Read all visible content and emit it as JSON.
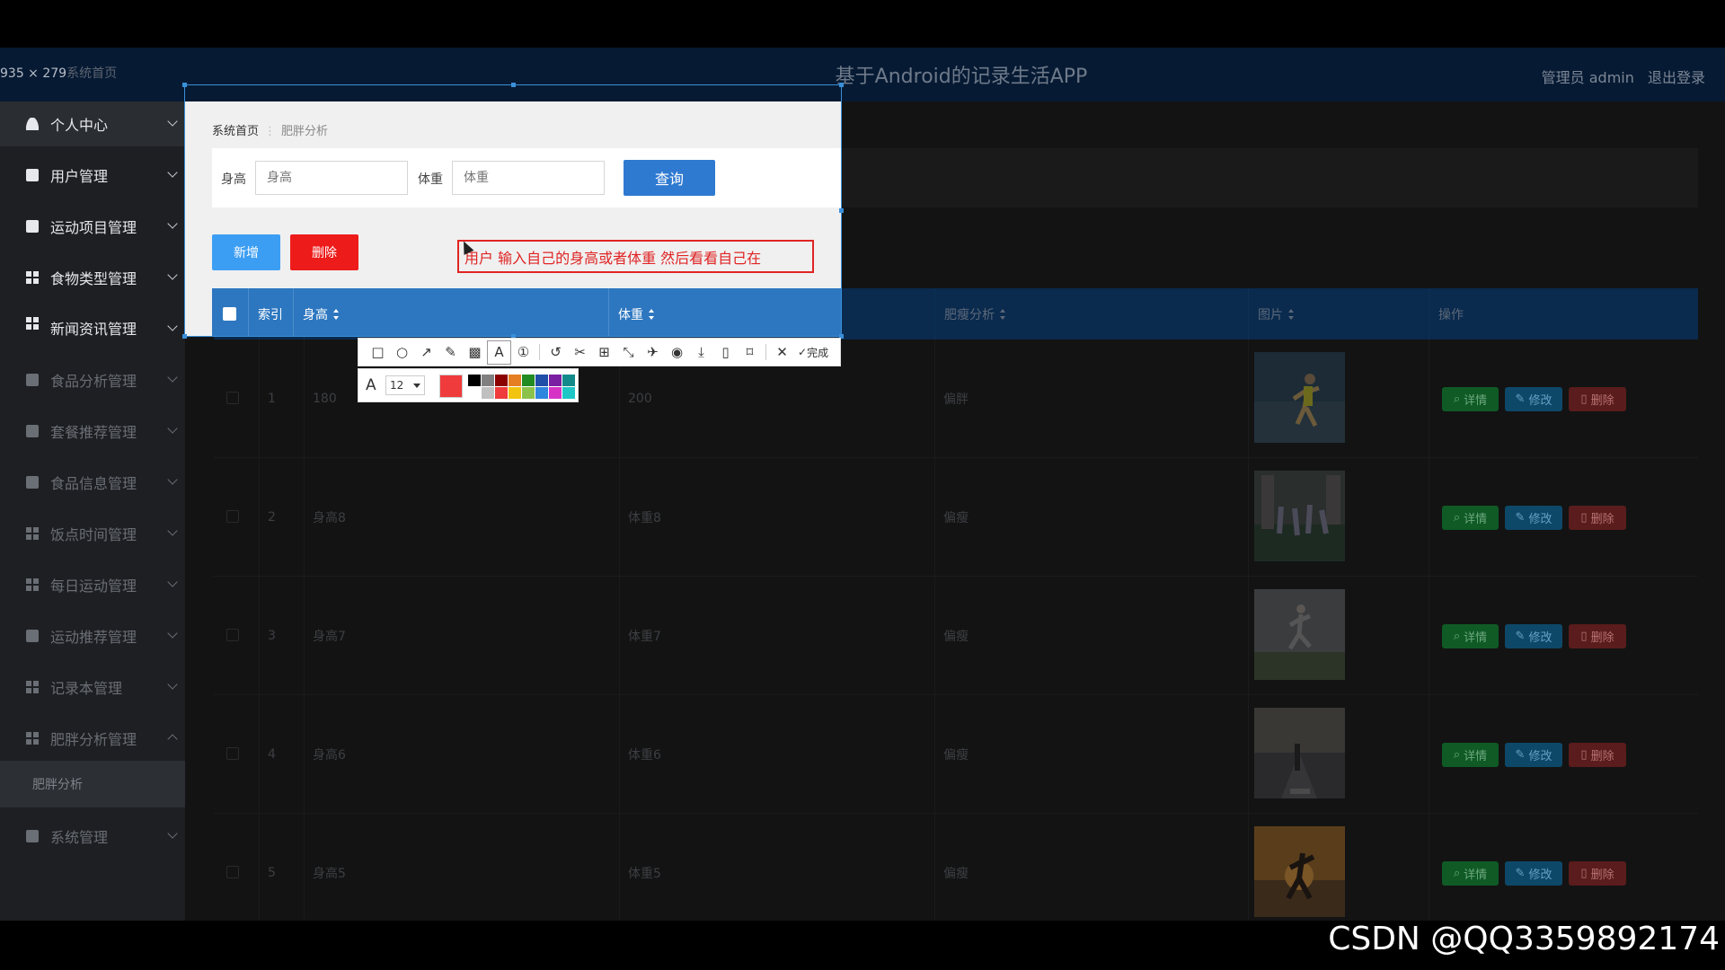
{
  "app": {
    "title": "基于Android的记录生活APP",
    "role_label": "管理员 admin",
    "logout": "退出登录"
  },
  "capture": {
    "size_readout": "935 × 279",
    "under_text": "系统首页"
  },
  "sidebar": {
    "items": [
      {
        "label": "个人中心",
        "icon": "user-icon"
      },
      {
        "label": "用户管理",
        "icon": "box-icon"
      },
      {
        "label": "运动项目管理",
        "icon": "clipboard-icon"
      },
      {
        "label": "食物类型管理",
        "icon": "grid-icon"
      },
      {
        "label": "新闻资讯管理",
        "icon": "grid-icon"
      },
      {
        "label": "食品分析管理",
        "icon": "box-icon"
      },
      {
        "label": "套餐推荐管理",
        "icon": "thumb-icon"
      },
      {
        "label": "食品信息管理",
        "icon": "flag-icon"
      },
      {
        "label": "饭点时间管理",
        "icon": "grid-icon"
      },
      {
        "label": "每日运动管理",
        "icon": "table-icon"
      },
      {
        "label": "运动推荐管理",
        "icon": "clipboard-icon"
      },
      {
        "label": "记录本管理",
        "icon": "grid-icon"
      },
      {
        "label": "肥胖分析管理",
        "icon": "grid-icon"
      },
      {
        "label": "系统管理",
        "icon": "monitor-icon"
      }
    ],
    "submenu": {
      "label": "肥胖分析"
    }
  },
  "breadcrumb": {
    "home": "系统首页",
    "separator": "⋮",
    "current": "肥胖分析"
  },
  "search": {
    "height_label": "身高",
    "height_placeholder": "身高",
    "weight_label": "体重",
    "weight_placeholder": "体重",
    "query_button": "查询"
  },
  "actions": {
    "add": "新增",
    "delete": "删除"
  },
  "annotation": {
    "text": "用户 输入自己的身高或者体重  然后看看自己在"
  },
  "table": {
    "headers": {
      "index": "索引",
      "height": "身高",
      "weight": "体重",
      "analysis": "肥瘦分析",
      "image": "图片",
      "ops": "操作"
    },
    "rows": [
      {
        "index": "1",
        "height": "180",
        "weight": "200",
        "analysis": "偏胖"
      },
      {
        "index": "2",
        "height": "身高8",
        "weight": "体重8",
        "analysis": "偏瘦"
      },
      {
        "index": "3",
        "height": "身高7",
        "weight": "体重7",
        "analysis": "偏瘦"
      },
      {
        "index": "4",
        "height": "身高6",
        "weight": "体重6",
        "analysis": "偏瘦"
      },
      {
        "index": "5",
        "height": "身高5",
        "weight": "体重5",
        "analysis": "偏瘦"
      }
    ],
    "op_labels": {
      "view": "详情",
      "edit": "修改",
      "delete": "删除"
    }
  },
  "toolbar": {
    "done": "完成",
    "font_size": "12",
    "current_color": "#ef3b3b",
    "palette": [
      "#000000",
      "#808080",
      "#8b0000",
      "#e67e22",
      "#228b22",
      "#1f4fa8",
      "#7b1fa2",
      "#138a8a",
      "#ffffff",
      "#c0c0c0",
      "#ef3b3b",
      "#f1c40f",
      "#8bc34a",
      "#2e86de",
      "#d633c6",
      "#1ec6c6"
    ]
  },
  "watermark": "CSDN @QQ3359892174"
}
